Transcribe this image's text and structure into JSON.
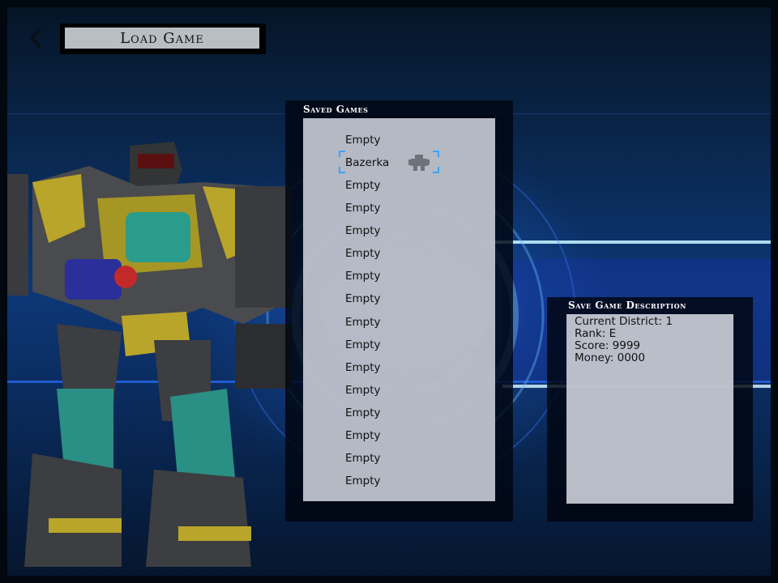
{
  "header": {
    "title": "Load Game",
    "back_icon": "chevron-left-icon"
  },
  "saved_games": {
    "heading": "Saved Games",
    "slots": [
      {
        "label": "Empty"
      },
      {
        "label": "Bazerka",
        "selected": true,
        "icon": "robot-icon"
      },
      {
        "label": "Empty"
      },
      {
        "label": "Empty"
      },
      {
        "label": "Empty"
      },
      {
        "label": "Empty"
      },
      {
        "label": "Empty"
      },
      {
        "label": "Empty"
      },
      {
        "label": "Empty"
      },
      {
        "label": "Empty"
      },
      {
        "label": "Empty"
      },
      {
        "label": "Empty"
      },
      {
        "label": "Empty"
      },
      {
        "label": "Empty"
      },
      {
        "label": "Empty"
      },
      {
        "label": "Empty"
      }
    ]
  },
  "description": {
    "heading": "Save Game Description",
    "lines": [
      "Current District: 1",
      "Rank: E",
      "Score: 9999",
      "Money: 0000"
    ]
  },
  "colors": {
    "accent": "#3aa3ff",
    "panel_bg": "#000510",
    "list_bg": "#cdd2dc"
  }
}
